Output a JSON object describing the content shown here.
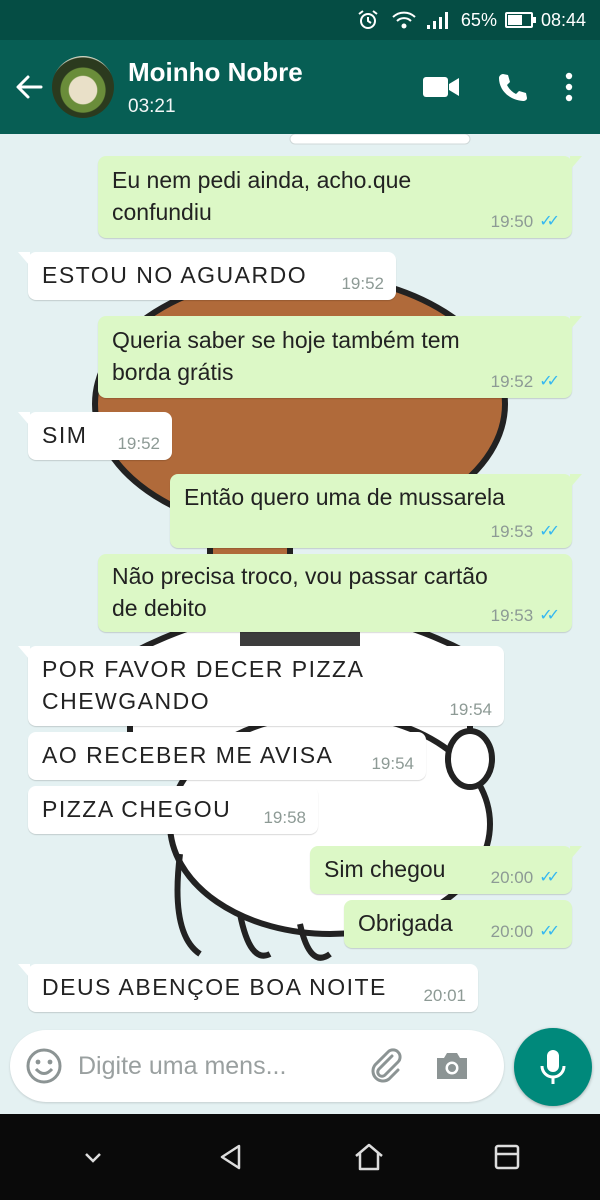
{
  "status_bar": {
    "battery": "65%",
    "time": "08:44",
    "icons": [
      "alarm-icon",
      "wifi-icon",
      "signal-icon",
      "battery-icon"
    ]
  },
  "header": {
    "contact_name": "Moinho Nobre",
    "subtitle": "03:21",
    "icons": [
      "back-arrow-icon",
      "video-call-icon",
      "phone-call-icon",
      "more-options-icon"
    ],
    "colors": {
      "bar": "#075e54",
      "status": "#054d44"
    }
  },
  "messages": [
    {
      "dir": "out",
      "lines": [
        "Eu nem pedi ainda, acho.que",
        "confundiu"
      ],
      "time": "19:50",
      "read": true
    },
    {
      "dir": "in",
      "lines": [
        "ESTOU NO AGUARDO"
      ],
      "time": "19:52"
    },
    {
      "dir": "out",
      "lines": [
        "Queria saber se hoje também tem",
        "borda grátis"
      ],
      "time": "19:52",
      "read": true
    },
    {
      "dir": "in",
      "lines": [
        "SIM"
      ],
      "time": "19:52"
    },
    {
      "dir": "out",
      "lines": [
        "Então quero uma de mussarela"
      ],
      "time": "19:53",
      "read": true
    },
    {
      "dir": "out",
      "lines": [
        "Não precisa troco, vou passar cartão",
        "de debito"
      ],
      "time": "19:53",
      "read": true
    },
    {
      "dir": "in",
      "lines": [
        "POR FAVOR DECER PIZZA",
        "CHEWGANDO"
      ],
      "time": "19:54"
    },
    {
      "dir": "in",
      "lines": [
        "AO RECEBER ME AVISA"
      ],
      "time": "19:54"
    },
    {
      "dir": "in",
      "lines": [
        "PIZZA CHEGOU"
      ],
      "time": "19:58"
    },
    {
      "dir": "out",
      "lines": [
        "Sim chegou"
      ],
      "time": "20:00",
      "read": true
    },
    {
      "dir": "out",
      "lines": [
        "Obrigada"
      ],
      "time": "20:00",
      "read": true
    },
    {
      "dir": "in",
      "lines": [
        "DEUS ABENÇOE BOA NOITE"
      ],
      "time": "20:01"
    }
  ],
  "composer": {
    "placeholder": "Digite uma mens...",
    "icons": [
      "emoji-icon",
      "paperclip-icon",
      "camera-icon",
      "microphone-icon"
    ],
    "accent": "#00897b"
  },
  "nav": {
    "icons": [
      "chevron-down-icon",
      "back-triangle-icon",
      "home-icon",
      "recents-icon"
    ]
  },
  "colors": {
    "bubble_in": "#ffffff",
    "bubble_out": "#dcf8c6",
    "read_ticks": "#34b7f1"
  }
}
